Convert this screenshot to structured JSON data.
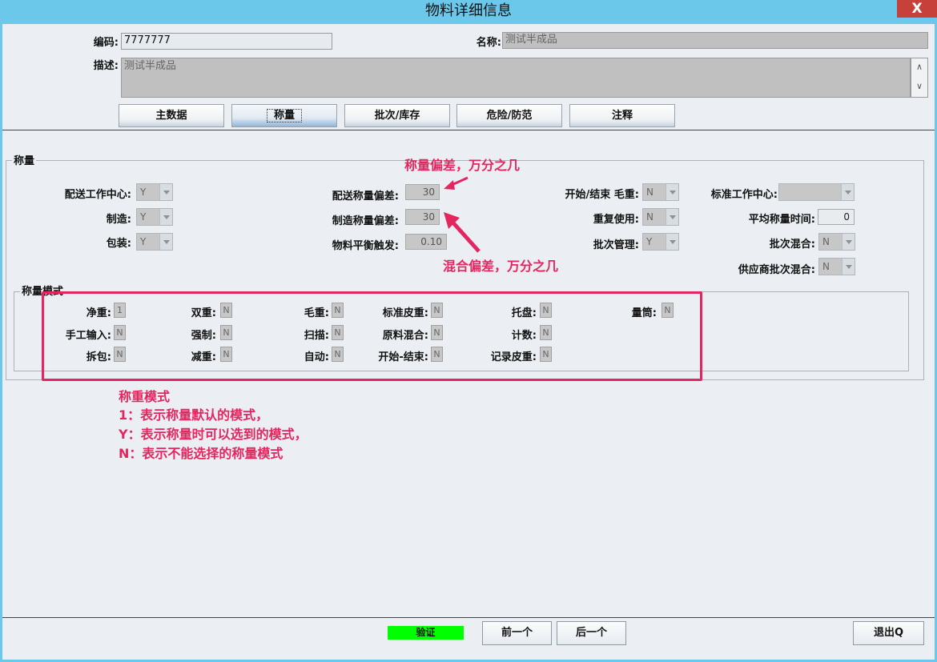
{
  "window": {
    "title": "物料详细信息",
    "close_label": "X"
  },
  "header": {
    "code_label": "编码:",
    "code_value": "7777777",
    "name_label": "名称:",
    "name_value": "测试半成品",
    "desc_label": "描述:",
    "desc_value": "测试半成品"
  },
  "tabs": [
    {
      "label": "主数据"
    },
    {
      "label": "称量"
    },
    {
      "label": "批次/库存"
    },
    {
      "label": "危险/防范"
    },
    {
      "label": "注释"
    }
  ],
  "weighing": {
    "legend": "称量",
    "dispatch_center_label": "配送工作中心:",
    "dispatch_center_value": "Y",
    "manufacture_label": "制造:",
    "manufacture_value": "Y",
    "package_label": "包装:",
    "package_value": "Y",
    "dispatch_dev_label": "配送称量偏差:",
    "dispatch_dev_value": "30",
    "manuf_dev_label": "制造称量偏差:",
    "manuf_dev_value": "30",
    "balance_trigger_label": "物料平衡触发:",
    "balance_trigger_value": "0.10",
    "start_end_gross_label": "开始/结束 毛重:",
    "start_end_gross_value": "N",
    "reuse_label": "重复使用:",
    "reuse_value": "N",
    "batch_mgmt_label": "批次管理:",
    "batch_mgmt_value": "Y",
    "std_center_label": "标准工作中心:",
    "std_center_value": "",
    "avg_time_label": "平均称量时间:",
    "avg_time_value": "0",
    "batch_mix_label": "批次混合:",
    "batch_mix_value": "N",
    "supplier_mix_label": "供应商批次混合:",
    "supplier_mix_value": "N"
  },
  "mode": {
    "legend": "称量模式",
    "rows": [
      [
        {
          "label": "净重:",
          "value": "1"
        },
        {
          "label": "双重:",
          "value": "N"
        },
        {
          "label": "毛重:",
          "value": "N"
        },
        {
          "label": "标准皮重:",
          "value": "N"
        },
        {
          "label": "托盘:",
          "value": "N"
        },
        {
          "label": "量筒:",
          "value": "N"
        }
      ],
      [
        {
          "label": "手工输入:",
          "value": "N"
        },
        {
          "label": "强制:",
          "value": "N"
        },
        {
          "label": "扫描:",
          "value": "N"
        },
        {
          "label": "原料混合:",
          "value": "N"
        },
        {
          "label": "计数:",
          "value": "N"
        }
      ],
      [
        {
          "label": "拆包:",
          "value": "N"
        },
        {
          "label": "减重:",
          "value": "N"
        },
        {
          "label": "自动:",
          "value": "N"
        },
        {
          "label": "开始-结束:",
          "value": "N"
        },
        {
          "label": "记录皮重:",
          "value": "N"
        }
      ]
    ]
  },
  "annotations": {
    "weigh_dev": "称量偏差，万分之几",
    "mix_dev": "混合偏差，万分之几",
    "mode_lines": [
      "称重模式",
      "1：表示称量默认的模式，",
      "Y：表示称量时可以选到的模式，",
      "N：表示不能选择的称量模式"
    ]
  },
  "footer": {
    "verify_label": "验证",
    "prev_label": "前一个",
    "next_label": "后一个",
    "exit_label": "退出Q"
  },
  "colors": {
    "accent": "#e3265f",
    "titlebar": "#6cc8ea",
    "close": "#c7403a",
    "verify": "#00ff00"
  }
}
